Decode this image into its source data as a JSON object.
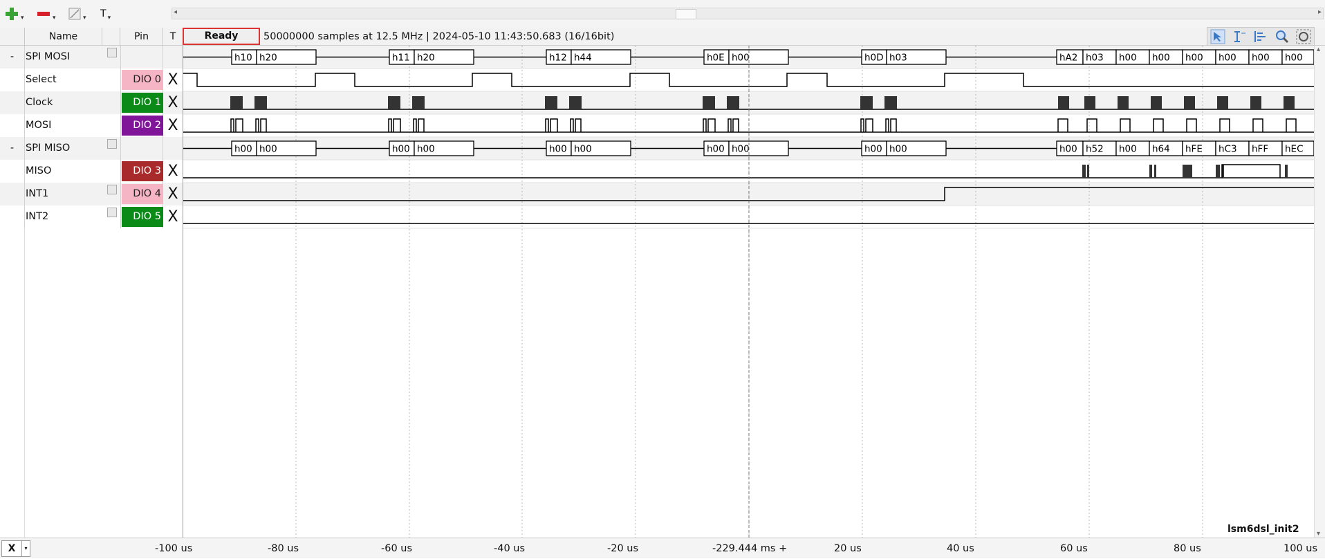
{
  "toolbar": {
    "items": [
      {
        "name": "add-channel",
        "icon": "plus-icon",
        "color": "#3aa336"
      },
      {
        "name": "remove-channel",
        "icon": "minus-icon",
        "color": "#d8202a"
      },
      {
        "name": "add-protocol",
        "icon": "edit-note-icon"
      },
      {
        "name": "text-tool",
        "icon": "text-icon",
        "label": "T"
      }
    ]
  },
  "header": {
    "name": "Name",
    "pin": "Pin",
    "trigger": "T",
    "status": "Ready",
    "info": "50000000 samples at 12.5 MHz | 2024-05-10 11:43:50.683 (16/16bit)"
  },
  "right_tools": [
    "cursor-icon",
    "measure-icon",
    "align-icon",
    "zoom-icon",
    "zoom-fit-icon"
  ],
  "channels": [
    {
      "expand": "-",
      "name": "SPI MOSI",
      "pin": "",
      "pin_color": "",
      "trigger": ""
    },
    {
      "expand": "",
      "name": "Select",
      "pin": "DIO  0",
      "pin_color": "#f5b5c5",
      "pin_text": "#222",
      "trigger": "X"
    },
    {
      "expand": "",
      "name": "Clock",
      "pin": "DIO  1",
      "pin_color": "#0b8a18",
      "pin_text": "#fff",
      "trigger": "X"
    },
    {
      "expand": "",
      "name": "MOSI",
      "pin": "DIO  2",
      "pin_color": "#80159a",
      "pin_text": "#fff",
      "trigger": "X"
    },
    {
      "expand": "-",
      "name": "SPI MISO",
      "pin": "",
      "pin_color": "",
      "trigger": ""
    },
    {
      "expand": "",
      "name": "MISO",
      "pin": "DIO  3",
      "pin_color": "#a82a2a",
      "pin_text": "#fff",
      "trigger": "X"
    },
    {
      "expand": "",
      "name": "INT1",
      "pin": "DIO  4",
      "pin_color": "#f5b5c5",
      "pin_text": "#222",
      "trigger": "X"
    },
    {
      "expand": "",
      "name": "INT2",
      "pin": "DIO  5",
      "pin_color": "#0b8a18",
      "pin_text": "#fff",
      "trigger": "X"
    }
  ],
  "mosi_frames": [
    [
      "h10",
      "h20"
    ],
    [
      "h11",
      "h20"
    ],
    [
      "h12",
      "h44"
    ],
    [
      "h0E",
      "h00"
    ],
    [
      "h0D",
      "h03"
    ],
    [
      "hA2",
      "h03",
      "h00",
      "h00",
      "h00",
      "h00",
      "h00",
      "h00"
    ]
  ],
  "miso_frames": [
    [
      "h00",
      "h00"
    ],
    [
      "h00",
      "h00"
    ],
    [
      "h00",
      "h00"
    ],
    [
      "h00",
      "h00"
    ],
    [
      "h00",
      "h00"
    ],
    [
      "h00",
      "h52",
      "h00",
      "h64",
      "hFE",
      "hC3",
      "hFF",
      "hEC"
    ]
  ],
  "session_name": "lsm6dsl_init2",
  "time_axis": {
    "labels": [
      "-100 us",
      "-80 us",
      "-60 us",
      "-40 us",
      "-20 us",
      "-229.444 ms +",
      "20 us",
      "40 us",
      "60 us",
      "80 us",
      "100 us"
    ],
    "unit_note": "us"
  },
  "status_bar": {
    "close": "X",
    "dropdown": "▾"
  }
}
